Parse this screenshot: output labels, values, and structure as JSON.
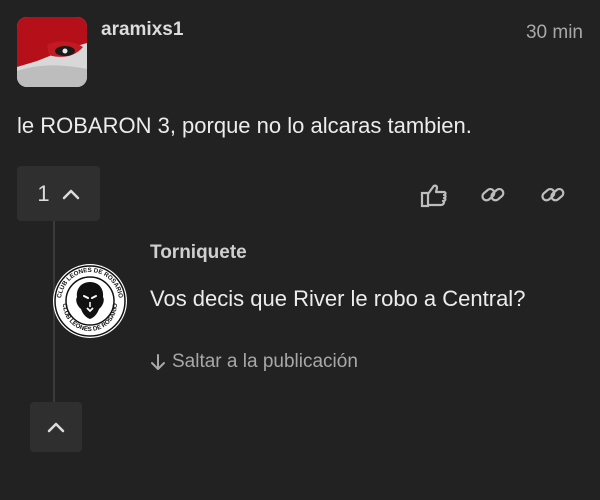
{
  "post": {
    "username": "aramixs1",
    "time": "30 min",
    "text": "le ROBARON 3, porque no lo alcaras tambien.",
    "vote_count": "1"
  },
  "icons": {
    "avatar": "god-of-war-avatar",
    "vote_up": "chevron-up-icon",
    "like": "thumbs-up-icon",
    "link1": "link-icon",
    "link2": "link-icon",
    "reply_avatar": "club-leones-de-rosario-logo",
    "jump": "arrow-down-icon",
    "collapse": "chevron-up-icon"
  },
  "reply": {
    "username": "Torniquete",
    "text": "Vos decis que River le robo a Central?",
    "logo_text": "CLUB LEONES DE ROSARIO"
  },
  "jump_link": "Saltar a la publicación",
  "colors": {
    "background": "#222222",
    "button_bg": "#2f2f2f",
    "text": "#ececec",
    "muted": "#a8a8a8"
  }
}
